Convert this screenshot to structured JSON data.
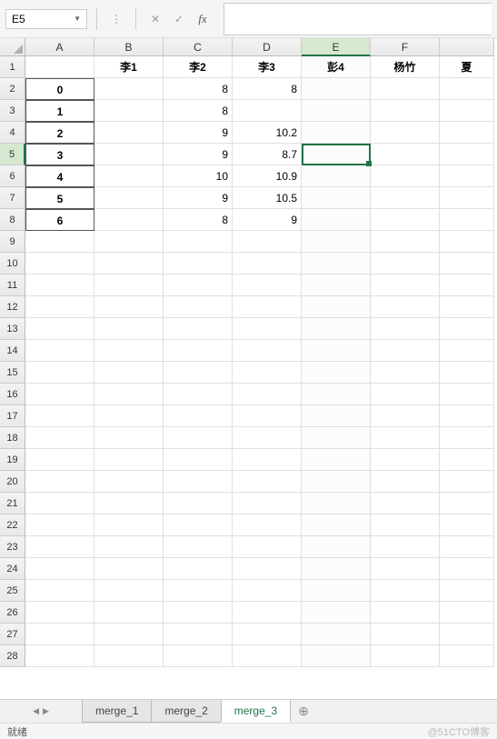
{
  "toolbar": {
    "namebox_value": "E5",
    "fx_label": "fx"
  },
  "columns": [
    "A",
    "B",
    "C",
    "D",
    "E",
    "F"
  ],
  "partial_col": "夏",
  "rows": [
    "1",
    "2",
    "3",
    "4",
    "5",
    "6",
    "7",
    "8",
    "9",
    "10",
    "11",
    "12",
    "13",
    "14",
    "15",
    "16",
    "17",
    "18",
    "19",
    "20",
    "21",
    "22",
    "23",
    "24",
    "25",
    "26",
    "27",
    "28"
  ],
  "active": {
    "col_index": 4,
    "row_index": 4,
    "col_label": "E",
    "row_label": "5"
  },
  "headers_row": [
    "",
    "李1",
    "李2",
    "李3",
    "彭4",
    "杨竹"
  ],
  "data_rows": [
    {
      "idx": "0",
      "B": "",
      "C": "8",
      "D": "8"
    },
    {
      "idx": "1",
      "B": "",
      "C": "8",
      "D": ""
    },
    {
      "idx": "2",
      "B": "",
      "C": "9",
      "D": "10.2"
    },
    {
      "idx": "3",
      "B": "",
      "C": "9",
      "D": "8.7"
    },
    {
      "idx": "4",
      "B": "",
      "C": "10",
      "D": "10.9"
    },
    {
      "idx": "5",
      "B": "",
      "C": "9",
      "D": "10.5"
    },
    {
      "idx": "6",
      "B": "",
      "C": "8",
      "D": "9"
    }
  ],
  "sheets": [
    {
      "name": "merge_1",
      "active": false
    },
    {
      "name": "merge_2",
      "active": false
    },
    {
      "name": "merge_3",
      "active": true
    }
  ],
  "status": {
    "ready": "就绪",
    "watermark": "@51CTO博客"
  },
  "chart_data": {
    "type": "table",
    "columns": [
      "",
      "李1",
      "李2",
      "李3",
      "彭4",
      "杨竹"
    ],
    "index": [
      0,
      1,
      2,
      3,
      4,
      5,
      6
    ],
    "data": {
      "李1": [
        null,
        null,
        null,
        null,
        null,
        null,
        null
      ],
      "李2": [
        8,
        8,
        9,
        9,
        10,
        9,
        8
      ],
      "李3": [
        8,
        null,
        10.2,
        8.7,
        10.9,
        10.5,
        9
      ],
      "彭4": [
        null,
        null,
        null,
        null,
        null,
        null,
        null
      ],
      "杨竹": [
        null,
        null,
        null,
        null,
        null,
        null,
        null
      ]
    }
  }
}
